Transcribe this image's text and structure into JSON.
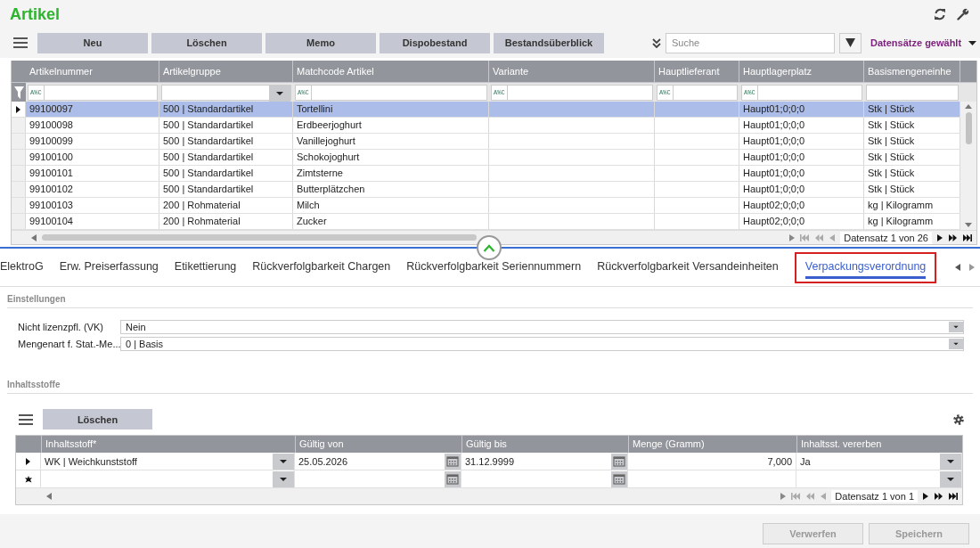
{
  "header": {
    "title": "Artikel"
  },
  "toolbar": {
    "buttons": [
      "Neu",
      "Löschen",
      "Memo",
      "Dispobestand",
      "Bestandsüberblick"
    ],
    "search": {
      "placeholder": "Suche"
    },
    "selection": "Datensätze gewählt"
  },
  "grid": {
    "columns": [
      "Artikelnummer",
      "Artikelgruppe",
      "Matchcode Artikel",
      "Variante",
      "Hauptlieferant",
      "Hauptlagerplatz",
      "Basismengeneinhe"
    ],
    "filters": [
      {
        "kind": "text",
        "operator": "A%C"
      },
      {
        "kind": "dropdown"
      },
      {
        "kind": "text",
        "operator": "A%C"
      },
      {
        "kind": "text",
        "operator": "A%C"
      },
      {
        "kind": "text",
        "operator": "A%C"
      },
      {
        "kind": "text",
        "operator": "A%C"
      },
      {
        "kind": "plain"
      }
    ],
    "rows": [
      {
        "selected": true,
        "cells": [
          "99100097",
          "500 | Standardartikel",
          "Tortellini",
          null,
          null,
          "Haupt01;0;0;0",
          "Stk | Stück"
        ]
      },
      {
        "selected": false,
        "cells": [
          "99100098",
          "500 | Standardartikel",
          "Erdbeerjoghurt",
          null,
          null,
          "Haupt01;0;0;0",
          "Stk | Stück"
        ]
      },
      {
        "selected": false,
        "cells": [
          "99100099",
          "500 | Standardartikel",
          "Vanillejoghurt",
          null,
          null,
          "Haupt01;0;0;0",
          "Stk | Stück"
        ]
      },
      {
        "selected": false,
        "cells": [
          "99100100",
          "500 | Standardartikel",
          "Schokojoghurt",
          null,
          null,
          "Haupt01;0;0;0",
          "Stk | Stück"
        ]
      },
      {
        "selected": false,
        "cells": [
          "99100101",
          "500 | Standardartikel",
          "Zimtsterne",
          null,
          null,
          "Haupt01;0;0;0",
          "Stk | Stück"
        ]
      },
      {
        "selected": false,
        "cells": [
          "99100102",
          "500 | Standardartikel",
          "Butterplätzchen",
          null,
          null,
          "Haupt01;0;0;0",
          "Stk | Stück"
        ]
      },
      {
        "selected": false,
        "cells": [
          "99100103",
          "200 | Rohmaterial",
          "Milch",
          null,
          null,
          "Haupt02;0;0;0",
          "kg | Kilogramm"
        ]
      },
      {
        "selected": false,
        "cells": [
          "99100104",
          "200 | Rohmaterial",
          "Zucker",
          null,
          null,
          "Haupt02;0;0;0",
          "kg | Kilogramm"
        ]
      }
    ],
    "pager": "Datensatz 1 von 26"
  },
  "tabs": [
    {
      "label": "ElektroG",
      "selected": false,
      "highlighted": false
    },
    {
      "label": "Erw. Preiserfassung",
      "selected": false,
      "highlighted": false
    },
    {
      "label": "Etikettierung",
      "selected": false,
      "highlighted": false
    },
    {
      "label": "Rückverfolgbarkeit Chargen",
      "selected": false,
      "highlighted": false
    },
    {
      "label": "Rückverfolgbarkeit Seriennummern",
      "selected": false,
      "highlighted": false
    },
    {
      "label": "Rückverfolgbarkeit Versandeinheiten",
      "selected": false,
      "highlighted": false
    },
    {
      "label": "Verpackungsverordnung",
      "selected": true,
      "highlighted": true
    }
  ],
  "settings": {
    "title": "Einstellungen",
    "fields": [
      {
        "label": "Nicht lizenzpfl. (VK)",
        "value": "Nein"
      },
      {
        "label": "Mengenart f. Stat.-Me...",
        "value": "0 | Basis"
      }
    ]
  },
  "ingredients": {
    "title": "Inhaltsstoffe",
    "buttons": [
      "Löschen"
    ],
    "columns": [
      {
        "label": "Inhaltsstoff*",
        "kind": "dropdown"
      },
      {
        "label": "Gültig von",
        "kind": "date"
      },
      {
        "label": "Gültig bis",
        "kind": "date"
      },
      {
        "label": "Menge (Gramm)",
        "kind": "number"
      },
      {
        "label": "Inhaltsst. vererben",
        "kind": "dropdown"
      }
    ],
    "rows": [
      {
        "kind": "current",
        "cells": [
          "WK | Weichkunststoff",
          "25.05.2026",
          "31.12.9999",
          "7,000",
          "Ja"
        ]
      },
      {
        "kind": "new",
        "cells": [
          null,
          null,
          null,
          null,
          null
        ]
      }
    ],
    "pager": "Datensatz 1 von 1"
  },
  "footer": {
    "buttons": [
      {
        "label": "Verwerfen",
        "disabled": true
      },
      {
        "label": "Speichern",
        "disabled": true
      }
    ]
  }
}
